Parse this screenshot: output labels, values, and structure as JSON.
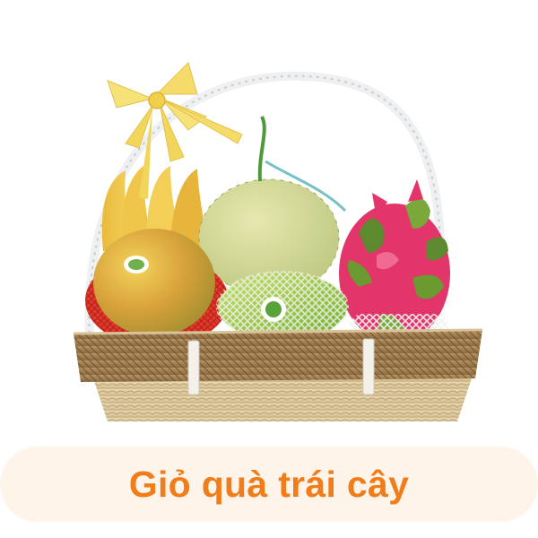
{
  "product": {
    "title": "Giỏ quà trái cây"
  },
  "image": {
    "subject": "fruit-gift-basket",
    "items": [
      "bow-ribbon-icon",
      "banana-icon",
      "mango-icon",
      "melon-icon",
      "green-mango-icon",
      "dragon-fruit-icon",
      "wicker-basket-icon"
    ]
  },
  "colors": {
    "title_text": "#f07d1a",
    "caption_background": "#fff4ea"
  }
}
